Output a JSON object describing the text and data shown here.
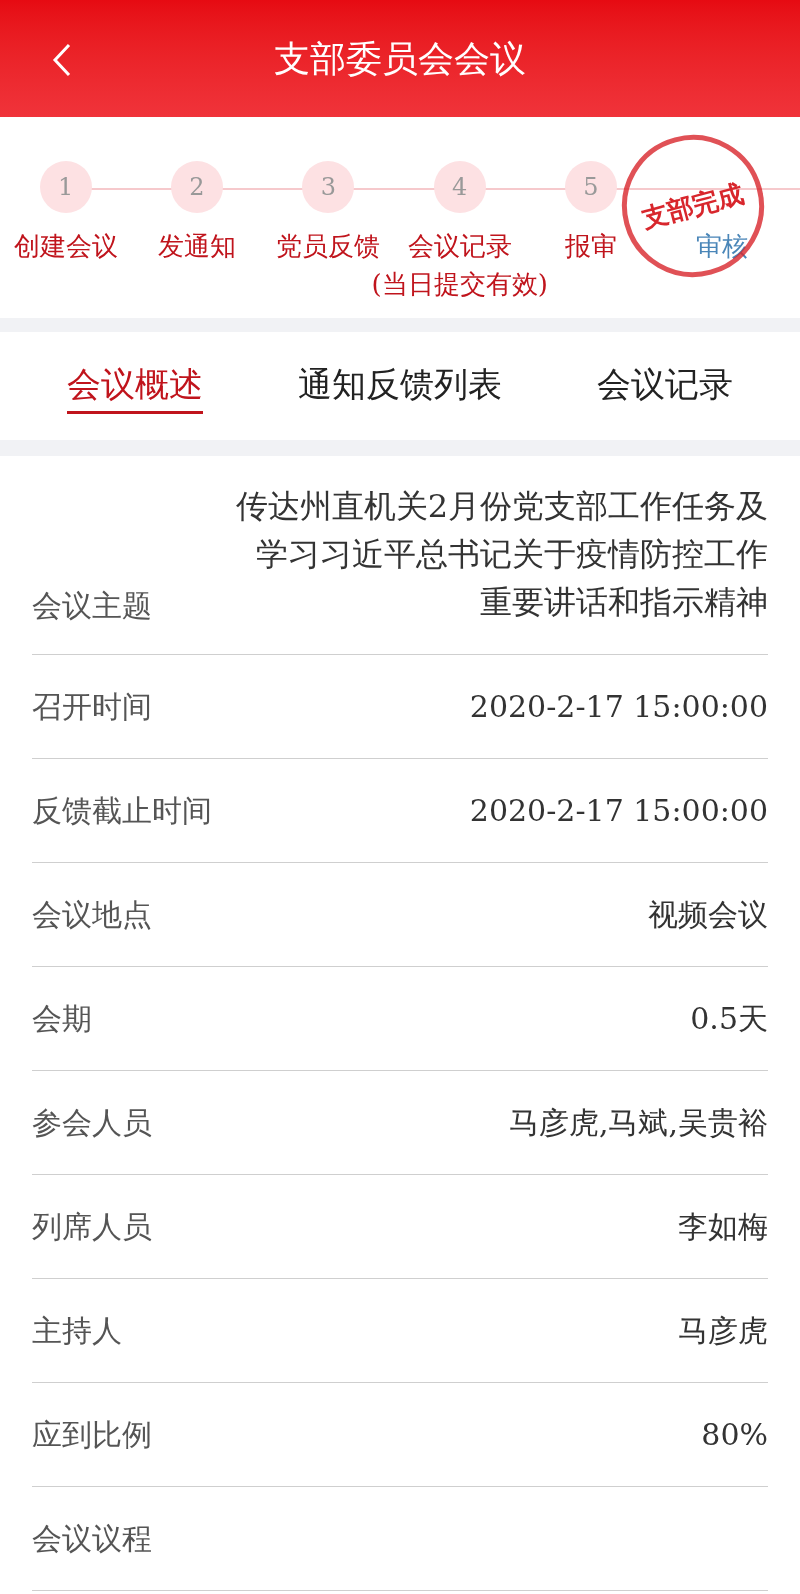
{
  "header": {
    "title": "支部委员会会议"
  },
  "steps": [
    {
      "number": "1",
      "label": "创建会议",
      "done": true
    },
    {
      "number": "2",
      "label": "发通知",
      "done": true
    },
    {
      "number": "3",
      "label": "党员反馈",
      "done": true
    },
    {
      "number": "4",
      "label": "会议记录",
      "note": "(当日提交有效)",
      "done": true
    },
    {
      "number": "5",
      "label": "报审",
      "done": true
    },
    {
      "label": "审核",
      "done": false
    }
  ],
  "stamp": {
    "text": "支部完成"
  },
  "tabs": [
    {
      "label": "会议概述",
      "selected": true
    },
    {
      "label": "通知反馈列表",
      "selected": false
    },
    {
      "label": "会议记录",
      "selected": false
    }
  ],
  "fields": [
    {
      "label": "会议主题",
      "value": "传达州直机关2月份党支部工作任务及学习习近平总书记关于疫情防控工作重要讲话和指示精神"
    },
    {
      "label": "召开时间",
      "value": "2020-2-17 15:00:00"
    },
    {
      "label": "反馈截止时间",
      "value": "2020-2-17 15:00:00"
    },
    {
      "label": "会议地点",
      "value": "视频会议"
    },
    {
      "label": "会期",
      "value": "0.5天"
    },
    {
      "label": "参会人员",
      "value": "马彦虎,马斌,吴贵裕"
    },
    {
      "label": "列席人员",
      "value": "李如梅"
    },
    {
      "label": "主持人",
      "value": "马彦虎"
    },
    {
      "label": "应到比例",
      "value": "80%"
    },
    {
      "label": "会议议程"
    }
  ]
}
